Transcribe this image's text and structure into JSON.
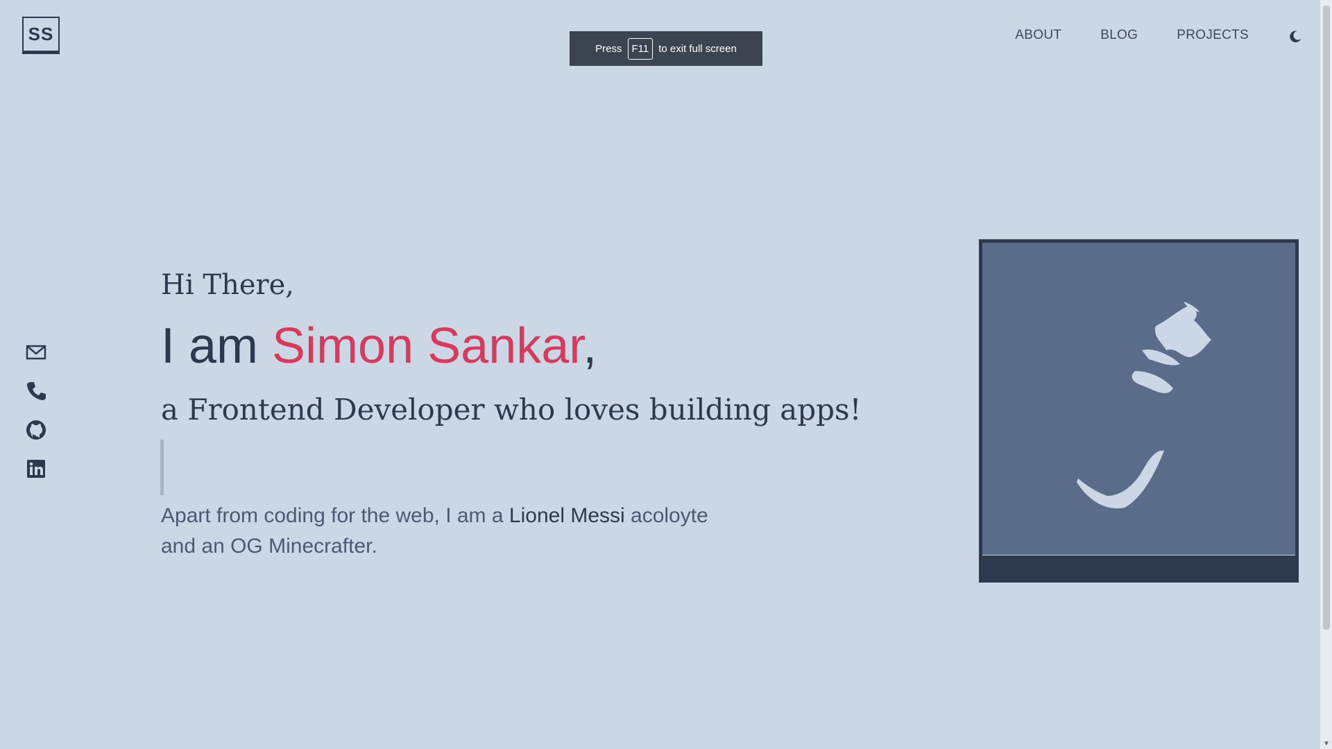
{
  "header": {
    "logo_text": "SS",
    "nav": [
      {
        "label": "ABOUT"
      },
      {
        "label": "BLOG"
      },
      {
        "label": "PROJECTS"
      }
    ],
    "theme_toggle_icon": "moon-icon"
  },
  "fullscreen_toast": {
    "prefix": "Press",
    "key": "F11",
    "suffix": "to exit full screen"
  },
  "hero": {
    "greeting": "Hi There,",
    "iam_prefix": "I am",
    "name": "Simon Sankar",
    "iam_suffix": ",",
    "role": "a Frontend Developer who loves building apps!",
    "bio_before": "Apart from coding for the web, I am a",
    "bio_highlight": "Lionel Messi",
    "bio_after": "acoloyte and an OG Minecrafter."
  },
  "socials": [
    {
      "icon": "mail-icon"
    },
    {
      "icon": "phone-icon"
    },
    {
      "icon": "github-icon"
    },
    {
      "icon": "linkedin-icon"
    }
  ],
  "colors": {
    "background": "#cbd7e5",
    "text": "#2d3a4d",
    "accent": "#d83a5c",
    "photo_bg": "#5a6c8a"
  }
}
